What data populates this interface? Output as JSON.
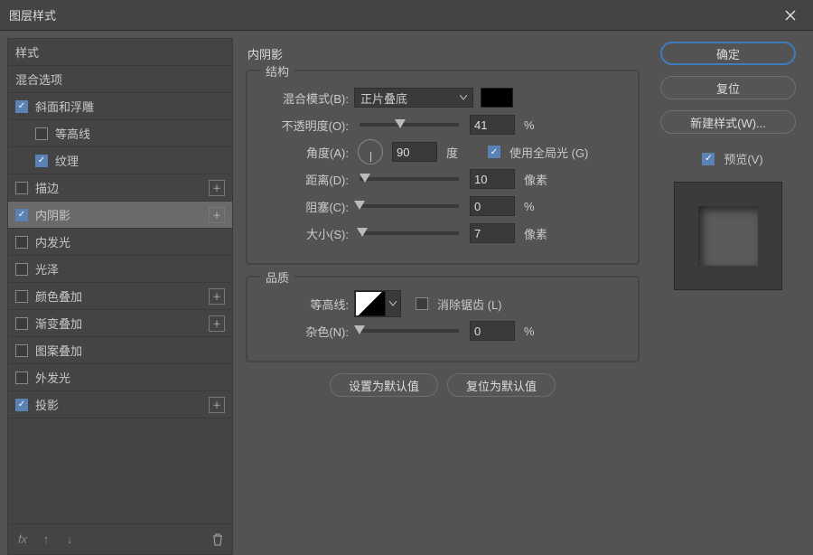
{
  "title": "图层样式",
  "styles": {
    "header": "样式",
    "blend": "混合选项",
    "bevel": "斜面和浮雕",
    "contour": "等高线",
    "texture": "纹理",
    "stroke": "描边",
    "innerShadow": "内阴影",
    "innerGlow": "内发光",
    "satin": "光泽",
    "colorOverlay": "颜色叠加",
    "gradientOverlay": "渐变叠加",
    "patternOverlay": "图案叠加",
    "outerGlow": "外发光",
    "dropShadow": "投影"
  },
  "panel": {
    "title": "内阴影",
    "structure": "结构",
    "blendMode": "混合模式(B):",
    "blendModeValue": "正片叠底",
    "opacity": "不透明度(O):",
    "opacityValue": "41",
    "opacityUnit": "%",
    "angle": "角度(A):",
    "angleValue": "90",
    "angleUnit": "度",
    "globalLight": "使用全局光 (G)",
    "distance": "距离(D):",
    "distanceValue": "10",
    "distanceUnit": "像素",
    "choke": "阻塞(C):",
    "chokeValue": "0",
    "chokeUnit": "%",
    "size": "大小(S):",
    "sizeValue": "7",
    "sizeUnit": "像素",
    "quality": "品质",
    "contourLabel": "等高线:",
    "antialias": "消除锯齿 (L)",
    "noise": "杂色(N):",
    "noiseValue": "0",
    "noiseUnit": "%",
    "makeDefault": "设置为默认值",
    "resetDefault": "复位为默认值"
  },
  "actions": {
    "ok": "确定",
    "cancel": "复位",
    "newStyle": "新建样式(W)...",
    "preview": "预览(V)"
  },
  "icons": {
    "fx": "fx",
    "up": "↑",
    "down": "↓"
  }
}
